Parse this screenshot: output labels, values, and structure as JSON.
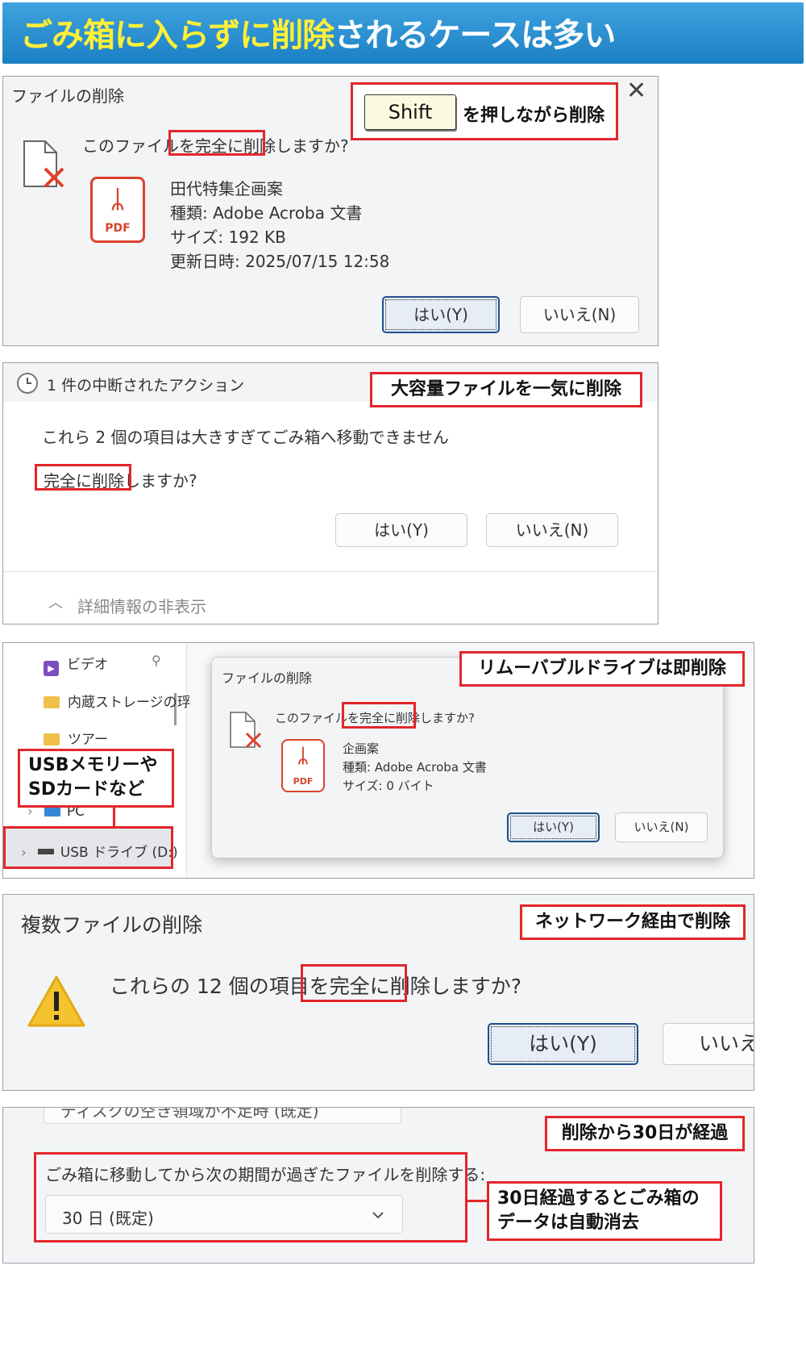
{
  "headline": {
    "yellow": "ごみ箱に入らずに削除",
    "white": "されるケースは多い"
  },
  "panel1": {
    "dialog_title": "ファイルの削除",
    "question_before": "このファイルを",
    "question_highlight": "完全に削除",
    "question_after": "しますか?",
    "file_name": "田代特集企画案",
    "file_type": "種類: Adobe Acroba 文書",
    "file_size": "サイズ: 192 KB",
    "file_modified": "更新日時: 2025/07/15 12:58",
    "pdf_label": "PDF",
    "yes": "はい(Y)",
    "no": "いいえ(N)",
    "key": "Shift",
    "callout": "を押しながら削除",
    "close": "✕"
  },
  "panel2": {
    "header": "1 件の中断されたアクション",
    "message": "これら 2 個の項目は大きすぎてごみ箱へ移動できません",
    "question_highlight": "完全に削除",
    "question_after": "しますか?",
    "yes": "はい(Y)",
    "no": "いいえ(N)",
    "details": "詳細情報の非表示",
    "callout": "大容量ファイルを一気に削除"
  },
  "panel3": {
    "nav": {
      "video": "ビデオ",
      "internal": "内蔵ストレージの琈",
      "tour": "ツアー",
      "pc": "PC",
      "usb": "USB ドライブ (D:)"
    },
    "dialog_title": "ファイルの削除",
    "question_before": "このファイルを",
    "question_highlight": "完全に削除",
    "question_after": "しますか?",
    "file_name": "企画案",
    "file_type": "種類: Adobe Acroba 文書",
    "file_size": "サイズ: 0 バイト",
    "pdf_label": "PDF",
    "yes": "はい(Y)",
    "no": "いいえ(N)",
    "callout_usb_line1": "USBメモリーや",
    "callout_usb_line2": "SDカードなど",
    "callout_right": "リムーバブルドライブは即削除"
  },
  "panel4": {
    "title": "複数ファイルの削除",
    "question_before": "これらの 12 個の項目を",
    "question_highlight": "完全に削除",
    "question_after": "しますか?",
    "yes": "はい(Y)",
    "no": "いいえ(",
    "callout": "ネットワーク経由で削除"
  },
  "panel5": {
    "cut_text": "ディスクの空き領域が不足時 (既定)",
    "setting_label": "ごみ箱に移動してから次の期間が過ぎたファイルを削除する:",
    "dropdown_value": "30 日 (既定)",
    "callout_top": "削除から30日が経過",
    "callout_line1": "30日経過するとごみ箱の",
    "callout_line2": "データは自動消去"
  },
  "colors": {
    "highlight_red": "#e3262b",
    "headline_yellow": "#ffef38",
    "headline_bg": "#1b7fc4",
    "pdf_red": "#d9432e"
  },
  "icons": [
    "document-delete-icon",
    "pdf-icon",
    "clock-icon",
    "chevron-up-icon",
    "video-icon",
    "folder-icon",
    "pc-icon",
    "usb-drive-icon",
    "pin-icon",
    "warning-icon",
    "chevron-down-icon",
    "close-icon"
  ]
}
